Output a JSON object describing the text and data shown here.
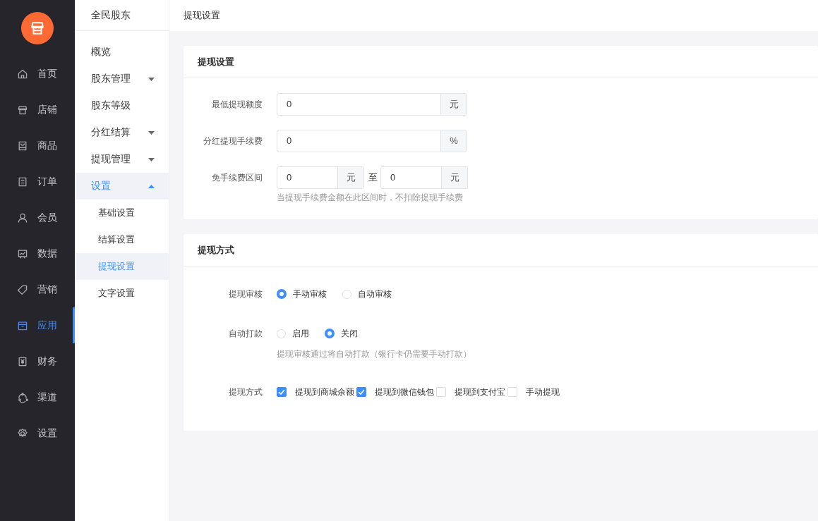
{
  "nav": [
    {
      "label": "首页",
      "selected": false
    },
    {
      "label": "店铺",
      "selected": false
    },
    {
      "label": "商品",
      "selected": false
    },
    {
      "label": "订单",
      "selected": false
    },
    {
      "label": "会员",
      "selected": false
    },
    {
      "label": "数据",
      "selected": false
    },
    {
      "label": "营销",
      "selected": false
    },
    {
      "label": "应用",
      "selected": true
    },
    {
      "label": "财务",
      "selected": false
    },
    {
      "label": "渠道",
      "selected": false
    },
    {
      "label": "设置",
      "selected": false
    }
  ],
  "submenu": {
    "title": "全民股东",
    "items": [
      {
        "label": "概览",
        "selected": false
      },
      {
        "label": "股东管理",
        "selected": false,
        "expanded": false
      },
      {
        "label": "股东等级",
        "selected": false
      },
      {
        "label": "分红结算",
        "selected": false,
        "expanded": false
      },
      {
        "label": "提现管理",
        "selected": false,
        "expanded": false
      },
      {
        "label": "设置",
        "selected": true,
        "expanded": true,
        "children": [
          {
            "label": "基础设置",
            "selected": false
          },
          {
            "label": "结算设置",
            "selected": false
          },
          {
            "label": "提现设置",
            "selected": true
          },
          {
            "label": "文字设置",
            "selected": false
          }
        ]
      }
    ]
  },
  "page_title": "提现设置",
  "sections": [
    {
      "title": "提现设置",
      "fields": [
        {
          "kind": "addon",
          "label": "最低提现额度",
          "value": "0",
          "unit": "元"
        },
        {
          "kind": "addon",
          "label": "分红提现手续费",
          "value": "0",
          "unit": "%"
        },
        {
          "kind": "range",
          "label": "免手续费区间",
          "from": {
            "value": "0",
            "unit": "元"
          },
          "separator": "至",
          "to": {
            "value": "0",
            "unit": "元"
          },
          "hint": "当提现手续费金额在此区间时，不扣除提现手续费"
        }
      ]
    },
    {
      "title": "提现方式",
      "fields": [
        {
          "kind": "radio",
          "label": "提现审核",
          "options": [
            {
              "label": "手动审核",
              "selected": true
            },
            {
              "label": "自动审核",
              "selected": false
            }
          ]
        },
        {
          "kind": "radio",
          "label": "自动打款",
          "options": [
            {
              "label": "启用",
              "selected": false
            },
            {
              "label": "关闭",
              "selected": true
            }
          ],
          "hint": "提现审核通过将自动打款（银行卡仍需要手动打款）"
        },
        {
          "kind": "checkbox",
          "label": "提现方式",
          "options": [
            {
              "label": "提现到商城余额",
              "checked": true
            },
            {
              "label": "提现到微信钱包",
              "checked": true
            },
            {
              "label": "提现到支付宝",
              "checked": false
            },
            {
              "label": "手动提现",
              "checked": false
            }
          ]
        }
      ]
    }
  ]
}
